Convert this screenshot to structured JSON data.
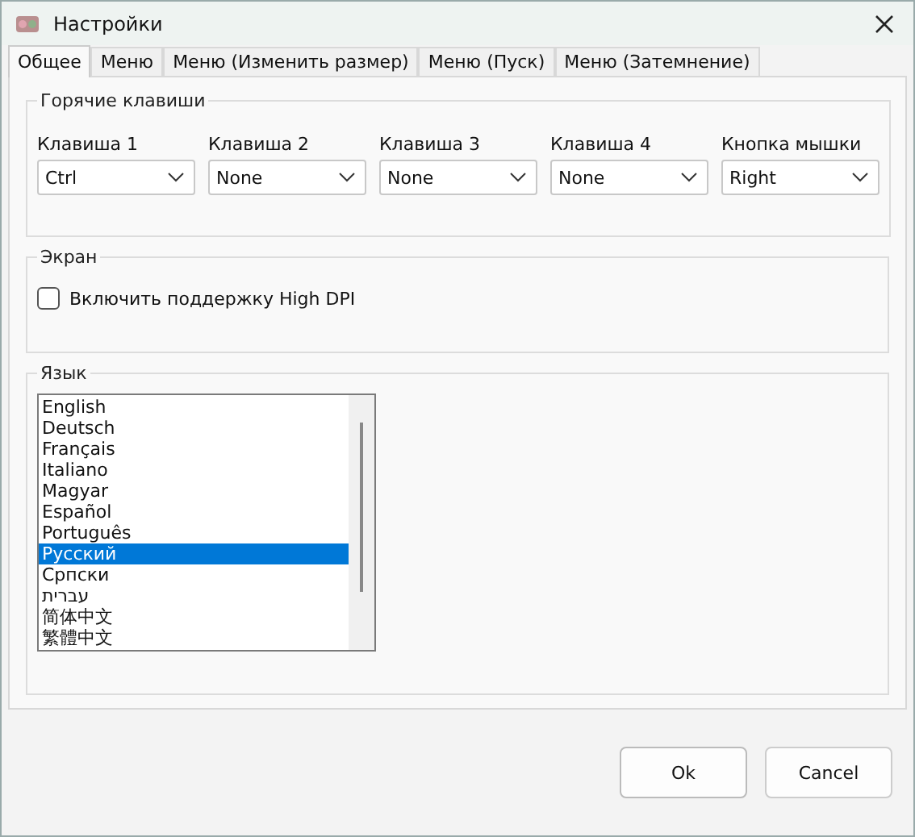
{
  "window": {
    "title": "Настройки"
  },
  "tabs": [
    {
      "label": "Общее",
      "selected": true
    },
    {
      "label": "Меню",
      "selected": false
    },
    {
      "label": "Меню (Изменить размер)",
      "selected": false
    },
    {
      "label": "Меню (Пуск)",
      "selected": false
    },
    {
      "label": "Меню (Затемнение)",
      "selected": false
    }
  ],
  "hotkeys": {
    "title": "Горячие клавиши",
    "fields": [
      {
        "label": "Клавиша 1",
        "value": "Ctrl"
      },
      {
        "label": "Клавиша 2",
        "value": "None"
      },
      {
        "label": "Клавиша 3",
        "value": "None"
      },
      {
        "label": "Клавиша 4",
        "value": "None"
      },
      {
        "label": "Кнопка мышки",
        "value": "Right"
      }
    ]
  },
  "screen": {
    "title": "Экран",
    "high_dpi": {
      "label": "Включить поддержку High DPI",
      "checked": false
    }
  },
  "language": {
    "title": "Язык",
    "items": [
      {
        "label": "English",
        "selected": false
      },
      {
        "label": "Deutsch",
        "selected": false
      },
      {
        "label": "Français",
        "selected": false
      },
      {
        "label": "Italiano",
        "selected": false
      },
      {
        "label": "Magyar",
        "selected": false
      },
      {
        "label": "Español",
        "selected": false
      },
      {
        "label": "Português",
        "selected": false
      },
      {
        "label": "Русский",
        "selected": true
      },
      {
        "label": "Српски",
        "selected": false
      },
      {
        "label": "עברית",
        "selected": false
      },
      {
        "label": "简体中文",
        "selected": false
      },
      {
        "label": "繁體中文",
        "selected": false
      }
    ]
  },
  "buttons": [
    "Ok",
    "Cancel"
  ]
}
